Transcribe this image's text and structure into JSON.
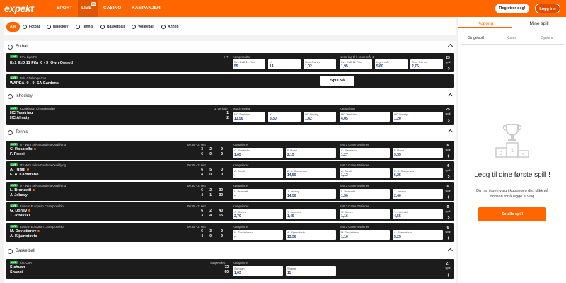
{
  "brand": {
    "logo": "expekt"
  },
  "topnav": {
    "sport": "SPORT",
    "live": "LIVE",
    "live_count": "15",
    "casino": "CASINO",
    "kampanjer": "KAMPANJER",
    "register": "Registrer deg!",
    "login": "Logg inn"
  },
  "filters": [
    "Alle",
    "Fotball",
    "Ishockey",
    "Tennis",
    "Basketball",
    "Volleyball",
    "Annen"
  ],
  "sections": {
    "fotball": "Fotball",
    "ishockey": "Ishockey",
    "tennis": "Tennis",
    "basketball": "Basketball"
  },
  "live_tag": "LIVE",
  "fotball": {
    "m1": {
      "league": "FIFA Liga Pro",
      "home": "Ez1 EzD 11 Fifa",
      "score": "0 - 3",
      "away": "Own Owned",
      "ht": "HT",
      "market1": "Kampresultat",
      "market2": "Neste lag til å score mål 4",
      "o": [
        {
          "n": "Ez1 EzD 11 Fifa",
          "v": "55"
        },
        {
          "n": "X",
          "v": "14"
        },
        {
          "n": "Own Owned",
          "v": "1,02"
        },
        {
          "n": "Ez1 EzD 11 Fifa",
          "v": "1,95"
        },
        {
          "n": "Ingen mål",
          "v": "5,60"
        },
        {
          "n": "Own Owned",
          "v": "2,75"
        }
      ],
      "more": "23",
      "more_label": "spill"
    },
    "m2": {
      "league": "Pak. Challenge Cup",
      "home": "WAPDA",
      "score": "0 - 0",
      "away": "SA Gardens",
      "button": "Spill Nå"
    }
  },
  "ishockey": {
    "m1": {
      "league": "Kazakhstan Championship",
      "home": "HC Temirtau",
      "away": "HC Almaty",
      "period": "3. periode",
      "s1": "1",
      "s2": "2",
      "market1": "Matchresultat",
      "market2": "Kampvinner",
      "o": [
        {
          "n": "HC Temirtau",
          "v": "13,50"
        },
        {
          "n": "X",
          "v": "3,30"
        },
        {
          "n": "HC Almaty",
          "v": "1,42"
        },
        {
          "n": "HC Temirtau",
          "v": "4,05"
        },
        {
          "n": "HC Almaty",
          "v": "1,20"
        }
      ],
      "more": "25",
      "more_label": "spill"
    }
  },
  "tennis": [
    {
      "league": "ITF W25 Selva Gardena Qualifying",
      "home": "C. Rosatello",
      "away": "F. Rossi",
      "time": "00:48 - 2. sett",
      "h": [
        "3",
        "2",
        "0"
      ],
      "a": [
        "6",
        "0",
        "0"
      ],
      "m1": "Kampvinner",
      "m2": "Sett 2 Game 3 Winner",
      "o": [
        {
          "n": "C. Rosatello",
          "v": "1,65"
        },
        {
          "n": "F. Rossi",
          "v": "2,15"
        },
        {
          "n": "C. Rosatello",
          "v": "1,27"
        },
        {
          "n": "F. Rossi",
          "v": "3,35"
        }
      ],
      "more": "6",
      "more_label": "spill"
    },
    {
      "league": "ITF W25 Selva Gardena Qualifying",
      "home": "A. Turati",
      "away": "E. A. Camerano",
      "time": "00:55 - 2. sett",
      "h": [
        "6",
        "5",
        "0"
      ],
      "a": [
        "4",
        "0",
        "0"
      ],
      "m1": "Kampvinner",
      "m2": "Sett 2 Game 6 Winner",
      "o": [
        {
          "n": "A. Turati",
          "v": "-"
        },
        {
          "n": "E. A. Camerano",
          "v": "14,50"
        },
        {
          "n": "A. Turati",
          "v": "1,13"
        },
        {
          "n": "E. A. Camerano",
          "v": "6,25"
        }
      ],
      "more": "4",
      "more_label": "spill"
    },
    {
      "league": "ITF W25 Selva Gardena Qualifying",
      "home": "L. Bronzetti",
      "away": "J. Jebavy",
      "time": "00:50 - 2. sett",
      "h": [
        "6",
        "2",
        "30"
      ],
      "a": [
        "4",
        "1",
        "30"
      ],
      "m1": "Kampvinner",
      "m2": "Sett 2 Game 4 Winner",
      "o": [
        {
          "n": "L. Bronzetti",
          "v": "-"
        },
        {
          "n": "J. Jebavy",
          "v": "14,50"
        },
        {
          "n": "L. Bronzetti",
          "v": "1,50"
        },
        {
          "n": "J. Jebavy",
          "v": "2,40"
        }
      ],
      "more": "6",
      "more_label": "spill"
    },
    {
      "league": "Eastern European Championship",
      "home": "G. Donev",
      "away": "T. Jotovski",
      "time": "00:55 - 2. sett",
      "h": [
        "6",
        "2",
        "40"
      ],
      "a": [
        "3",
        "4",
        "15"
      ],
      "m1": "Kampvinner",
      "m2": "Sett 2 Game 7 Winner",
      "o": [
        {
          "n": "G. Donev",
          "v": "2,70"
        },
        {
          "n": "T. Jotovski",
          "v": "1,45"
        },
        {
          "n": "G. Donev",
          "v": "1,16"
        },
        {
          "n": "T. Jotovski",
          "v": "4,55"
        }
      ],
      "more": "9",
      "more_label": "spill"
    },
    {
      "league": "Eastern European Championship",
      "home": "M. Deviatiarov",
      "away": "A. Kijamotovic",
      "time": "00:55 - 2. sett",
      "h": [
        "6",
        "3",
        "0"
      ],
      "a": [
        "4",
        "0",
        "0"
      ],
      "m1": "Kampvinner",
      "m2": "Sett 2 Game 4 Winner",
      "o": [
        {
          "n": "M. Deviatiarov",
          "v": "-"
        },
        {
          "n": "A. Kijamotovic",
          "v": "13,50"
        },
        {
          "n": "M. Deviatiarov",
          "v": "1,10"
        },
        {
          "n": "A. Kijamotovic",
          "v": "5,25"
        }
      ],
      "more": "6",
      "more_label": "spill"
    }
  ],
  "basketball": {
    "m1": {
      "league": "Kin. CBA",
      "home": "Sichuan",
      "away": "Shanxi",
      "status": "Suspendert",
      "s1": "72",
      "s2": "60",
      "market1": "Kampvinner",
      "o": [
        {
          "n": "Sichuan",
          "v": "1,03"
        },
        {
          "n": "Shanxi",
          "v": "11"
        }
      ],
      "more": "27",
      "more_label": "spill"
    }
  },
  "coupon": {
    "tab1": "Kupong",
    "tab2": "Mine spill",
    "sub1": "Singelspill",
    "sub2": "Kombi",
    "sub3": "System",
    "empty_title": "Legg til dine første spill !",
    "empty_text": "Du har ingen valg i kupongen din, klikk på oddsen for å legge til valg",
    "button": "Se alle spill"
  },
  "colors": {
    "accent": "#ff6600",
    "dark": "#1c1c1c",
    "live": "#1fa83c"
  }
}
